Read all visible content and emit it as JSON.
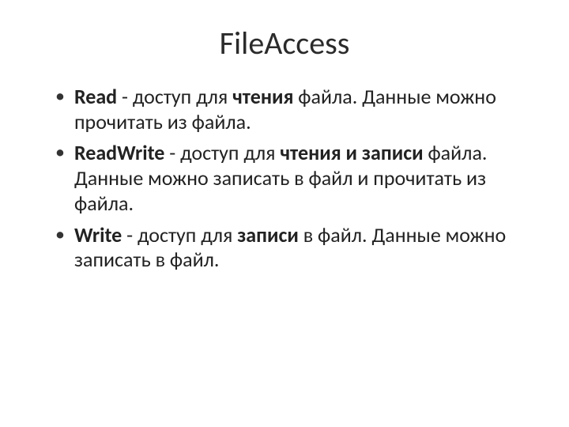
{
  "title": "FileAccess",
  "items": [
    {
      "kw": "Read",
      "sep": " - доступ для ",
      "emph": "чтения",
      "rest": " файла. Данные можно прочитать из файла."
    },
    {
      "kw": "ReadWrite",
      "sep": " - доступ для ",
      "emph": "чтения и записи",
      "rest": " файла. Данные можно записать в файл и прочитать из файла."
    },
    {
      "kw": "Write",
      "sep": " - доступ для ",
      "emph": "записи",
      "rest": " в файл. Данные можно записать в файл."
    }
  ]
}
